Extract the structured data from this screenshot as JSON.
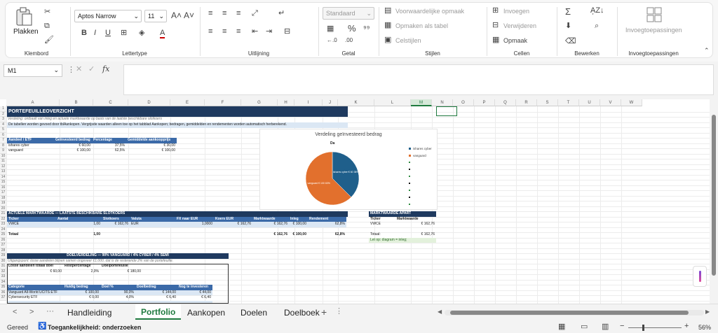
{
  "ribbon": {
    "clipboard": {
      "paste": "Plakken",
      "group": "Klembord"
    },
    "font": {
      "family": "Aptos Narrow",
      "size": "11",
      "group": "Lettertype"
    },
    "alignment": {
      "group": "Uitlijning"
    },
    "number": {
      "format": "Standaard",
      "group": "Getal"
    },
    "styles": {
      "conditional": "Voorwaardelijke opmaak",
      "as_table": "Opmaken als tabel",
      "cell_styles": "Celstijlen",
      "group": "Stijlen"
    },
    "cells": {
      "insert": "Invoegen",
      "delete": "Verwijderen",
      "format": "Opmaak",
      "group": "Cellen"
    },
    "editing": {
      "group": "Bewerken"
    },
    "addins": {
      "label": "Invoegtoepassingen",
      "group": "Invoegtoepassingen"
    }
  },
  "formula_bar": {
    "name_box": "M1",
    "fx": "fx",
    "content": ""
  },
  "columns": [
    "A",
    "B",
    "C",
    "D",
    "E",
    "F",
    "G",
    "H",
    "I",
    "J",
    "K",
    "L",
    "M",
    "N",
    "O",
    "P",
    "Q",
    "R",
    "S",
    "T",
    "U",
    "V",
    "W"
  ],
  "rows": [
    "1",
    "2",
    "3",
    "4",
    "5",
    "6",
    "7",
    "8",
    "9",
    "10",
    "11",
    "12",
    "13",
    "14",
    "15",
    "16",
    "17",
    "18",
    "19",
    "20",
    "21",
    "22",
    "23",
    "24",
    "25",
    "26",
    "27",
    "28",
    "29",
    "30",
    "31",
    "32",
    "33",
    "34",
    "35",
    "36",
    "37"
  ],
  "portfolio": {
    "title": "PORTEFEUILLEOVERZICHT",
    "line2": "Verdeling: ontbaalt van inleg en actuele marktwaarde op basis van de laatste beschikbare slotkoers",
    "line3": "De tabellen worden gevoed door tblAankopen. Vergrijsde waarden alleen toe op het tabblad Aankopen; bedragen, gemiddelden en rendementen worden automatisch herberekend.",
    "t1_headers": [
      "Aandeel / ETF",
      "Geïnvesteerd bedrag",
      "Percentage",
      "Gemiddelde aankoopprijs"
    ],
    "t1_rows": [
      [
        "ishares cyber",
        "€ 60,00",
        "37,5%",
        "€ 30,00"
      ],
      [
        "vanguard",
        "€ 100,00",
        "62,5%",
        "€ 100,00"
      ]
    ],
    "t2_title": "ACTUELE MARKTWAARDE — LAATSTE BESCHIKBARE SLOTKOERS",
    "t2_headers": [
      "Ticker",
      "Aantal",
      "Slotkoers",
      "Valuta",
      "FX naar EUR",
      "Koers EUR",
      "Marktwaarde",
      "Inleg",
      "Rendement"
    ],
    "t2_row": [
      "VWCE",
      "1,00",
      "€ 162,76",
      "EUR",
      "1,0000",
      "€ 162,76",
      "€ 162,76",
      "€ 100,00",
      "62,8%"
    ],
    "t2_total": [
      "Totaal",
      "1,00",
      "",
      "",
      "",
      "",
      "€ 162,76",
      "€ 100,00",
      "62,8%"
    ],
    "t3_title": "MARKTWAARDE APART",
    "t3_headers": [
      "Ticker",
      "Marktwaarde"
    ],
    "t3_row": [
      "VWCE",
      "€ 162,76"
    ],
    "t3_total": [
      "Totaal:",
      "€ 162,76"
    ],
    "t3_note": "Let op: diagram = inleg;",
    "t4_title": "DOELVERDELING — 90% VANGUARD / 4% CYBER / 4% SEMI",
    "t4_sub": "Uitgangspunt: losse aandelen blijven samen ongeveer €1.000, dat is de resterende 2% van de portefeuille.",
    "t4_headers": [
      "Losse aandelen totaal doel",
      "Restpercentage",
      "Doelportefeuille"
    ],
    "t4_values": [
      "€ 60,00",
      "2,0%",
      "€ 180,00"
    ],
    "t5_headers": [
      "Categorie",
      "Huidig bedrag",
      "Doel %",
      "Doelbedrag",
      "Nog te investeren"
    ],
    "t5_rows": [
      [
        "Vanguard All-World UCITS ETF",
        "€ 100,00",
        "90,0%",
        "€ 144,00",
        "€ 44,00"
      ],
      [
        "Cybersecurity ETF",
        "€ 0,00",
        "4,0%",
        "€ 6,40",
        "€ 6,40"
      ],
      [
        "",
        "",
        "",
        "",
        ""
      ]
    ]
  },
  "chart": {
    "title": "Verdeling geïnvesteerd bedrag",
    "top_label": "Da",
    "legend": [
      "ishares cyber",
      "vanguard"
    ],
    "slices": [
      {
        "name": "ishares cyber",
        "value": 60,
        "color": "#1f5f8b"
      },
      {
        "name": "vanguard",
        "value": 100,
        "color": "#e2702d"
      }
    ],
    "slice_labels": [
      "ishares cyber € 60 38%",
      "vanguard € 100 63%"
    ]
  },
  "tabs": [
    "Handleiding",
    "Portfolio",
    "Aankopen",
    "Doelen",
    "Doelboek"
  ],
  "active_tab": "Portfolio",
  "status": {
    "ready": "Gereed",
    "accessibility": "Toegankelijkheid: onderzoeken",
    "zoom": "56%"
  }
}
